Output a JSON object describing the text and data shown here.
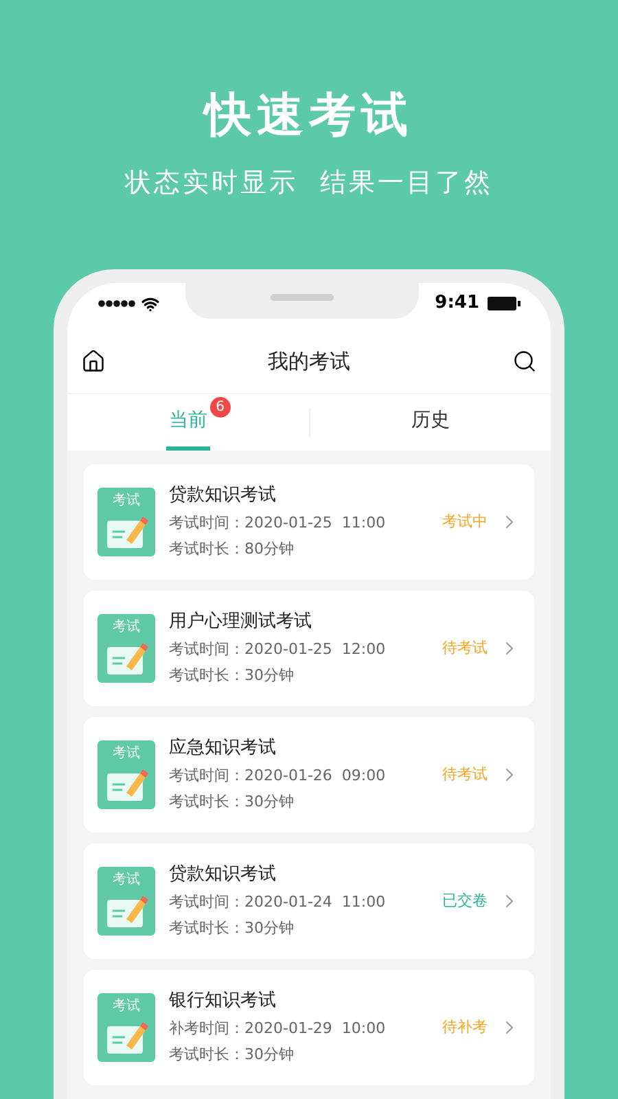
{
  "hero": {
    "title": "快速考试",
    "subtitle": "状态实时显示  结果一目了然"
  },
  "status_bar": {
    "time": "9:41"
  },
  "nav": {
    "title": "我的考试"
  },
  "tabs": [
    {
      "label": "当前",
      "selected": true,
      "badge": "6"
    },
    {
      "label": "历史",
      "selected": false
    }
  ],
  "exams": [
    {
      "thumb_label": "考试",
      "name": "贷款知识考试",
      "time": "考试时间：2020-01-25  11:00",
      "duration": "考试时长：80分钟",
      "status": "考试中",
      "color": "#f5a623"
    },
    {
      "thumb_label": "考试",
      "name": "用户心理测试考试",
      "time": "考试时间：2020-01-25  12:00",
      "duration": "考试时长：30分钟",
      "status": "待考试",
      "color": "#f5a623"
    },
    {
      "thumb_label": "考试",
      "name": "应急知识考试",
      "time": "考试时间：2020-01-26  09:00",
      "duration": "考试时长：30分钟",
      "status": "待考试",
      "color": "#f5a623"
    },
    {
      "thumb_label": "考试",
      "name": "贷款知识考试",
      "time": "考试时间：2020-01-24  11:00",
      "duration": "考试时长：30分钟",
      "status": "已交卷",
      "color": "#2bb39a"
    },
    {
      "thumb_label": "考试",
      "name": "银行知识考试",
      "time": "补考时间：2020-01-29  10:00",
      "duration": "考试时长：30分钟",
      "status": "待补考",
      "color": "#f5a623"
    }
  ]
}
